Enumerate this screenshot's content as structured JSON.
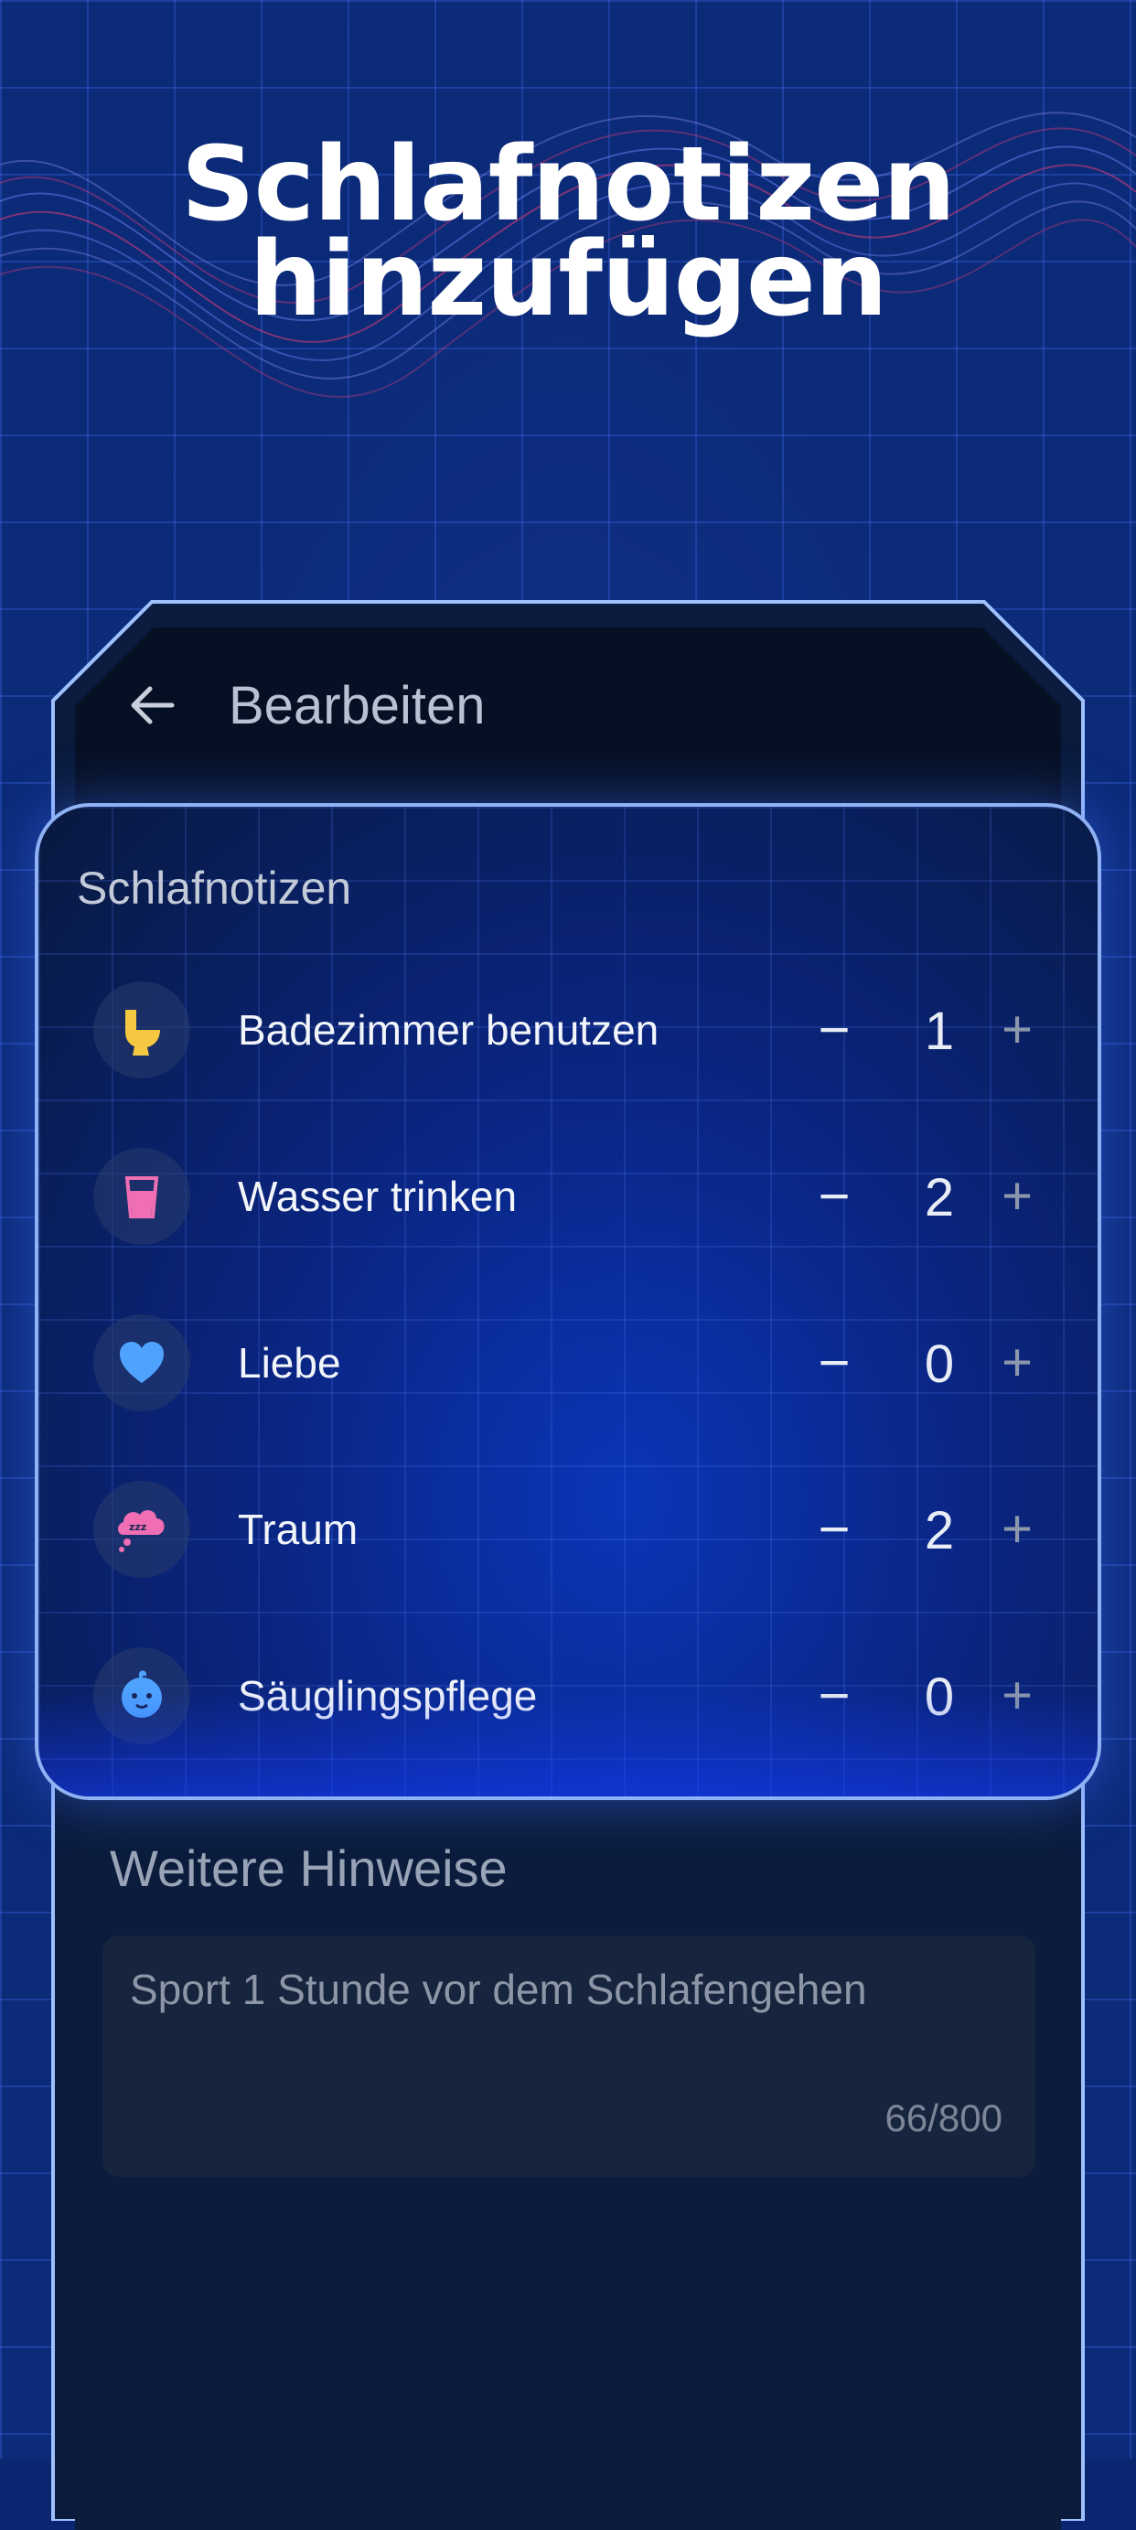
{
  "headline": [
    "Schlafnotizen",
    "hinzufügen"
  ],
  "header": {
    "title": "Bearbeiten"
  },
  "card": {
    "title": "Schlafnotizen",
    "items": [
      {
        "label": "Badezimmer benutzen",
        "count": "1",
        "icon": "toilet-icon"
      },
      {
        "label": "Wasser trinken",
        "count": "2",
        "icon": "water-glass-icon"
      },
      {
        "label": "Liebe",
        "count": "0",
        "icon": "heart-icon"
      },
      {
        "label": "Traum",
        "count": "2",
        "icon": "dream-cloud-icon"
      },
      {
        "label": "Säuglingspflege",
        "count": "0",
        "icon": "baby-icon"
      }
    ],
    "minus_symbol": "−",
    "plus_symbol": "+"
  },
  "notes": {
    "title": "Weitere Hinweise",
    "text": "Sport 1 Stunde vor dem Schlafengehen",
    "counter": "66/800"
  },
  "colors": {
    "background": "#0b2a78",
    "card_border": "#8fb2f4",
    "toilet": "#f5c842",
    "water": "#f06fb4",
    "heart": "#4fa3ff",
    "dream": "#f06fb4",
    "baby": "#4fa3ff"
  }
}
